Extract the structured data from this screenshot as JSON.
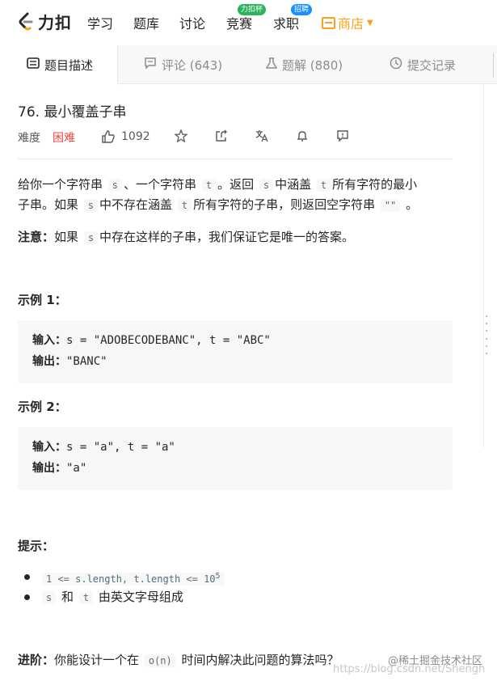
{
  "nav": {
    "logo_text": "力扣",
    "items": [
      {
        "label": "学习"
      },
      {
        "label": "题库"
      },
      {
        "label": "讨论"
      },
      {
        "label": "竞赛",
        "badge": "力扣杯"
      },
      {
        "label": "求职",
        "badge": "招聘"
      }
    ],
    "store_label": "商店",
    "store_color": "#ffa116"
  },
  "tabs": [
    {
      "label": "题目描述",
      "icon": "description-icon"
    },
    {
      "label": "评论 (643)",
      "icon": "comment-icon"
    },
    {
      "label": "题解 (880)",
      "icon": "flask-icon"
    },
    {
      "label": "提交记录",
      "icon": "clock-icon"
    }
  ],
  "problem": {
    "title": "76. 最小覆盖子串",
    "difficulty_label": "难度",
    "difficulty": "困难",
    "difficulty_color": "#ef4743",
    "likes": "1092"
  },
  "description": {
    "line1_a": "给你一个字符串",
    "s": "s",
    "line1_b": "、一个字符串",
    "t": "t",
    "line1_c": "。返回",
    "line1_d": "中涵盖",
    "line1_e": "所有字符的最小",
    "line2_a": "子串。如果",
    "line2_b": "中不存在涵盖",
    "line2_c": "所有字符的子串，则返回空字符串",
    "empty_str": "\"\"",
    "line2_d": "。",
    "note_label": "注意：",
    "note_a": "如果",
    "note_b": "中存在这样的子串，我们保证它是唯一的答案。"
  },
  "examples": [
    {
      "heading": "示例 1：",
      "input_label": "输入：",
      "input": "s = \"ADOBECODEBANC\", t = \"ABC\"",
      "output_label": "输出：",
      "output": "\"BANC\""
    },
    {
      "heading": "示例 2：",
      "input_label": "输入：",
      "input": "s = \"a\", t = \"a\"",
      "output_label": "输出：",
      "output": "\"a\""
    }
  ],
  "hints": {
    "heading": "提示：",
    "item1_code": "1 <= s.length, t.length <= 10",
    "item1_sup": "5",
    "item2_and": "和",
    "item2_rest": "由英文字母组成"
  },
  "advanced": {
    "label": "进阶：",
    "text_a": "你能设计一个在",
    "code": "o(n)",
    "text_b": "时间内解决此问题的算法吗？"
  },
  "watermark": {
    "text1": "@稀土掘金技术社区",
    "text2": "https://blog.csdn.net/Shengh"
  }
}
